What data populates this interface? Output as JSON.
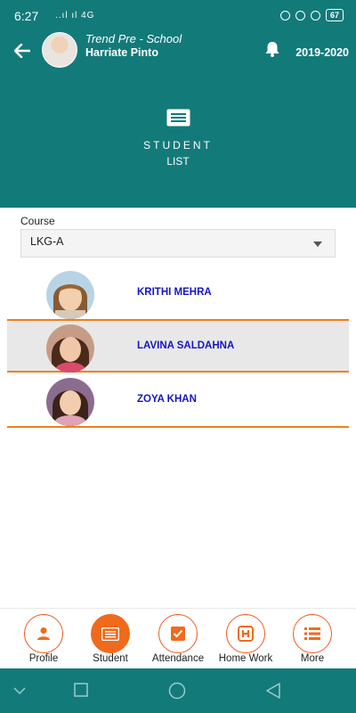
{
  "status_bar": {
    "time": "6:27",
    "signal": "..ıl ıl 4G",
    "battery": "67"
  },
  "header": {
    "school": "Trend Pre - School",
    "teacher": "Harriate Pinto",
    "year": "2019-2020",
    "back_icon": "arrow-left-icon",
    "bell_icon": "bell-icon"
  },
  "banner": {
    "title": "STUDENT",
    "subtitle": "LIST",
    "icon": "list-card-icon"
  },
  "course": {
    "label": "Course",
    "selected": "LKG-A"
  },
  "students": [
    {
      "name": "KRITHI MEHRA",
      "selected": false
    },
    {
      "name": "LAVINA SALDAHNA",
      "selected": true
    },
    {
      "name": "ZOYA KHAN",
      "selected": false
    }
  ],
  "bottom_nav": [
    {
      "label": "Profile",
      "icon": "person-icon",
      "active": false
    },
    {
      "label": "Student",
      "icon": "list-card-icon",
      "active": true
    },
    {
      "label": "Attendance",
      "icon": "checkbox-icon",
      "active": false
    },
    {
      "label": "Home Work",
      "icon": "homework-h-icon",
      "active": false
    },
    {
      "label": "More",
      "icon": "menu-list-icon",
      "active": false
    }
  ],
  "colors": {
    "teal": "#137a7a",
    "orange": "#f06a1e",
    "name_blue": "#1414c8"
  }
}
